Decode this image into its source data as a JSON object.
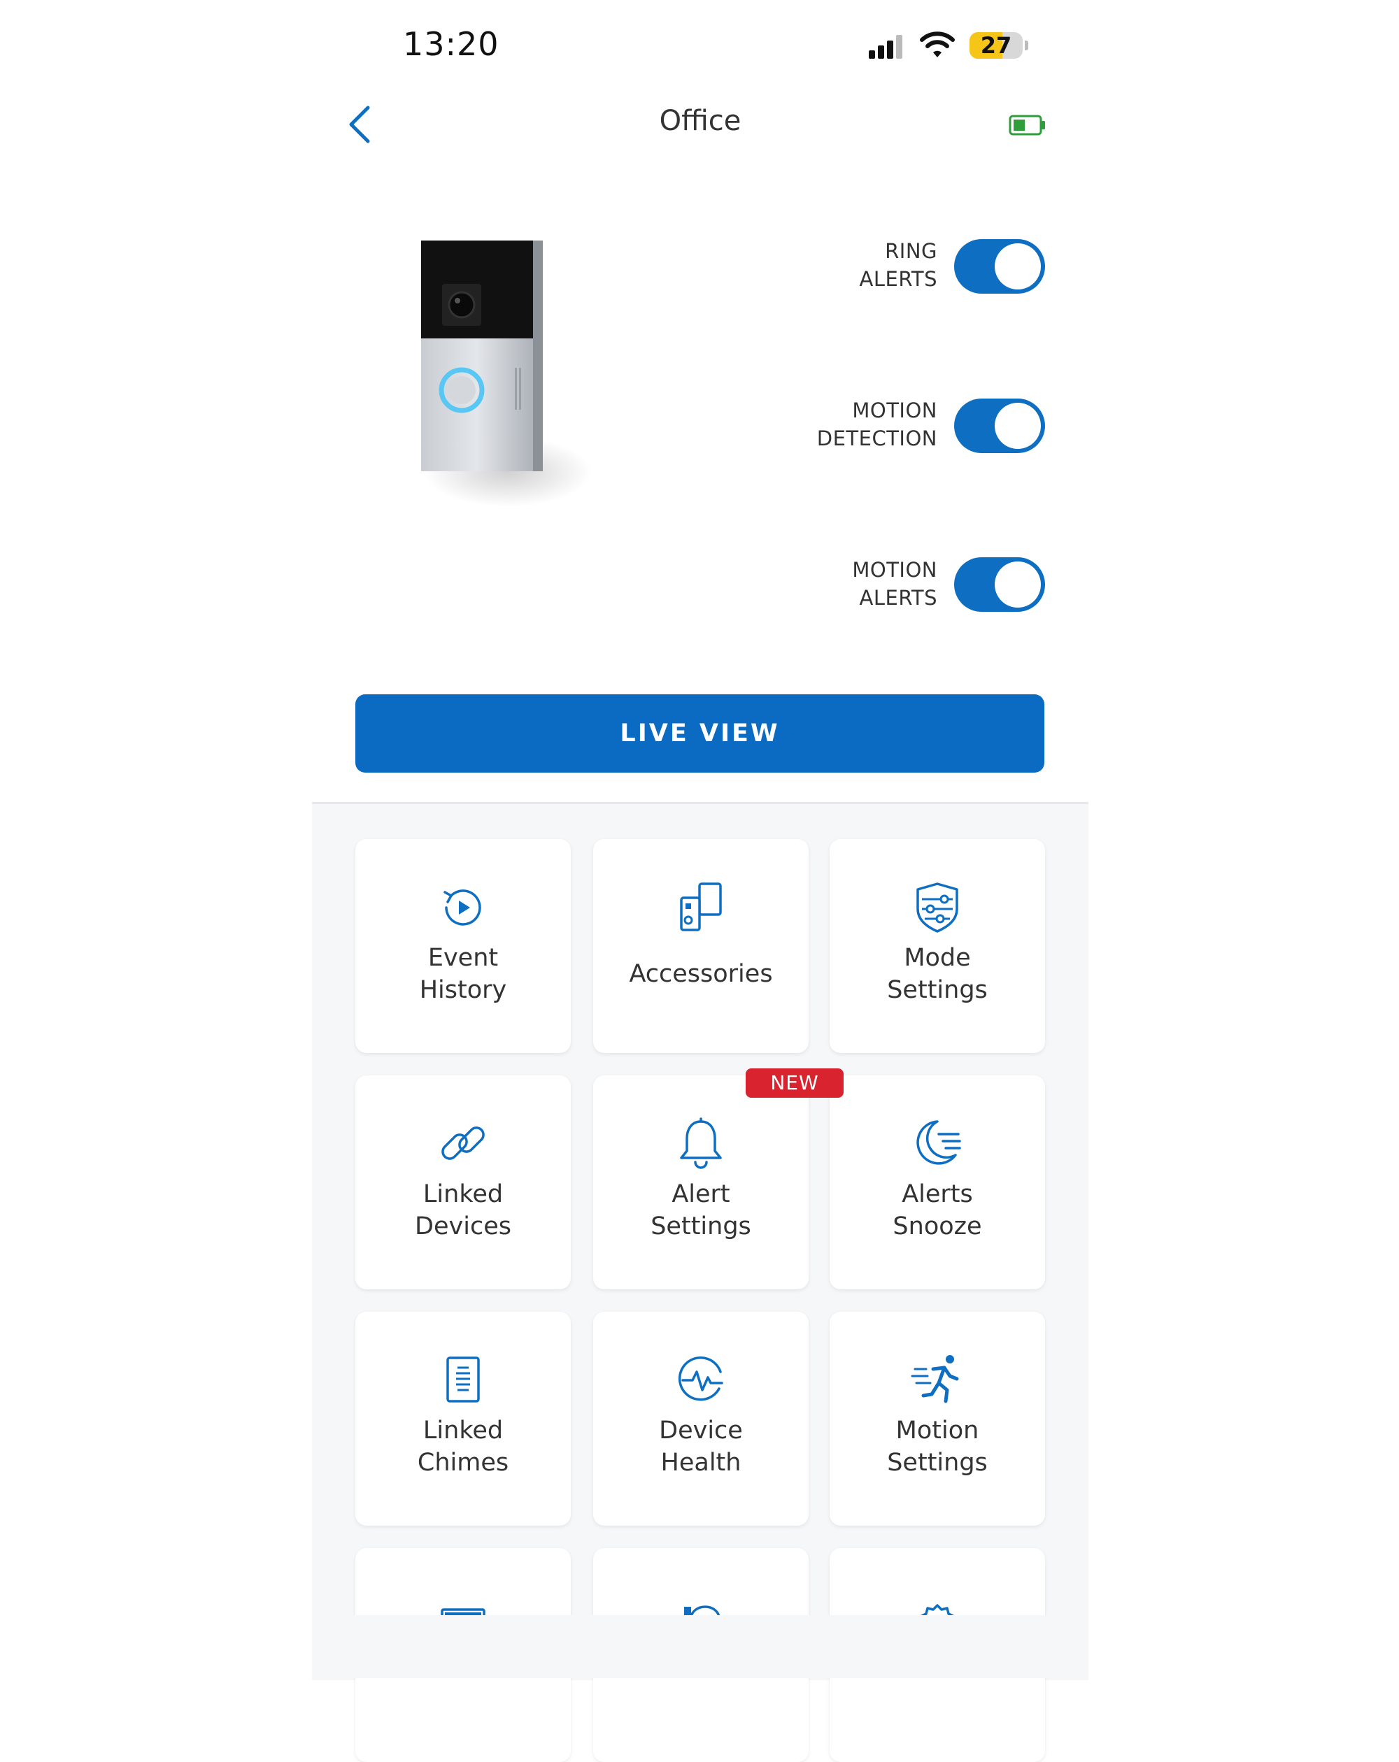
{
  "status_bar": {
    "time": "13:20",
    "battery_level": "27"
  },
  "nav": {
    "title": "Office"
  },
  "toggles": [
    {
      "line1": "RING",
      "line2": "ALERTS",
      "on": true
    },
    {
      "line1": "MOTION",
      "line2": "DETECTION",
      "on": true
    },
    {
      "line1": "MOTION",
      "line2": "ALERTS",
      "on": true
    }
  ],
  "live_view": {
    "label": "LIVE VIEW"
  },
  "tiles": [
    {
      "line1": "Event",
      "line2": "History",
      "icon": "event-history-icon"
    },
    {
      "line1": "Accessories",
      "line2": "",
      "icon": "accessories-icon"
    },
    {
      "line1": "Mode",
      "line2": "Settings",
      "icon": "mode-settings-icon"
    },
    {
      "line1": "Linked",
      "line2": "Devices",
      "icon": "linked-devices-icon"
    },
    {
      "line1": "Alert",
      "line2": "Settings",
      "icon": "alert-bell-icon",
      "badge": "NEW"
    },
    {
      "line1": "Alerts",
      "line2": "Snooze",
      "icon": "alerts-snooze-moon-icon"
    },
    {
      "line1": "Linked",
      "line2": "Chimes",
      "icon": "linked-chimes-icon"
    },
    {
      "line1": "Device",
      "line2": "Health",
      "icon": "device-health-icon"
    },
    {
      "line1": "Motion",
      "line2": "Settings",
      "icon": "motion-settings-runner-icon"
    }
  ],
  "colors": {
    "accent": "#0b6ac2",
    "badge": "#d9232f",
    "battery_green": "#2e9e3a",
    "battery_yellow": "#f5c518"
  }
}
